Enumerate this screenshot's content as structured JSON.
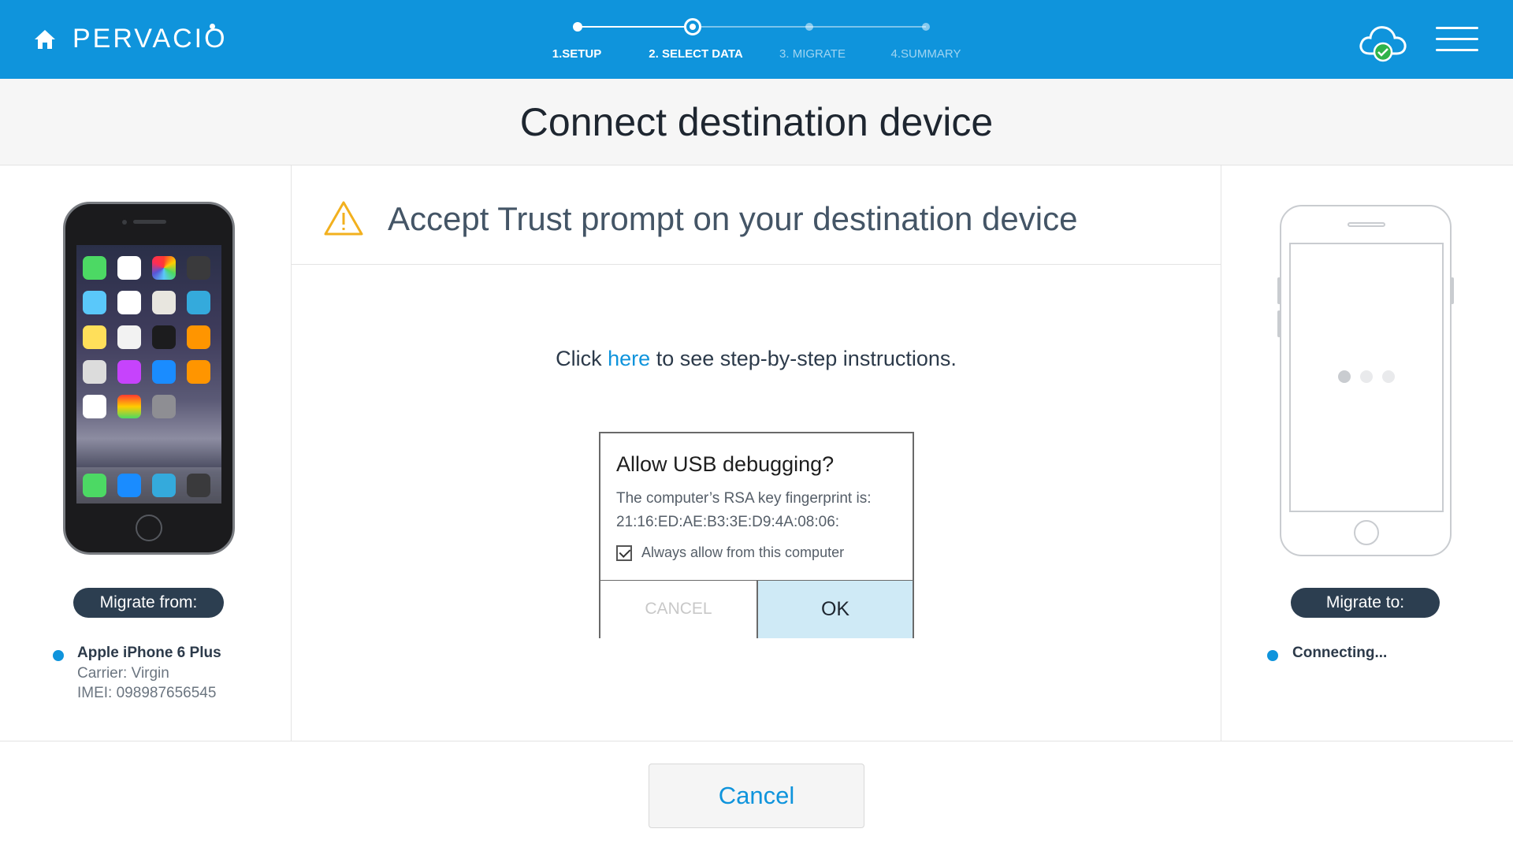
{
  "header": {
    "brand": "PERVACIO",
    "steps": [
      {
        "label": "1.SETUP",
        "state": "done"
      },
      {
        "label": "2. SELECT DATA",
        "state": "current"
      },
      {
        "label": "3. MIGRATE",
        "state": "pending"
      },
      {
        "label": "4.SUMMARY",
        "state": "pending"
      }
    ],
    "icons": {
      "home": "home-icon",
      "cloud": "cloud-check-icon",
      "menu": "hamburger-menu-icon"
    }
  },
  "title": "Connect destination device",
  "source": {
    "badge": "Migrate from:",
    "name": "Apple iPhone 6 Plus",
    "carrier": "Carrier: Virgin",
    "imei": "IMEI: 098987656545"
  },
  "main": {
    "warning": "Accept Trust prompt on your destination device",
    "instructions_before": "Click",
    "instructions_link": "here",
    "instructions_after": "to see step-by-step instructions."
  },
  "dialog": {
    "title": "Allow USB debugging?",
    "body_line1": "The computer’s RSA key fingerprint is:",
    "body_line2": "21:16:ED:AE:B3:3E:D9:4A:08:06:",
    "checkbox_label": "Always allow from this computer",
    "checkbox_checked": true,
    "cancel_label": "CANCEL",
    "ok_label": "OK"
  },
  "destination": {
    "badge": "Migrate to:",
    "status": "Connecting..."
  },
  "footer": {
    "cancel_label": "Cancel"
  },
  "colors": {
    "accent": "#0f94dc",
    "badge": "#2c3e50",
    "ok_button": "#cfeaf6",
    "warning": "#f2b01e"
  }
}
